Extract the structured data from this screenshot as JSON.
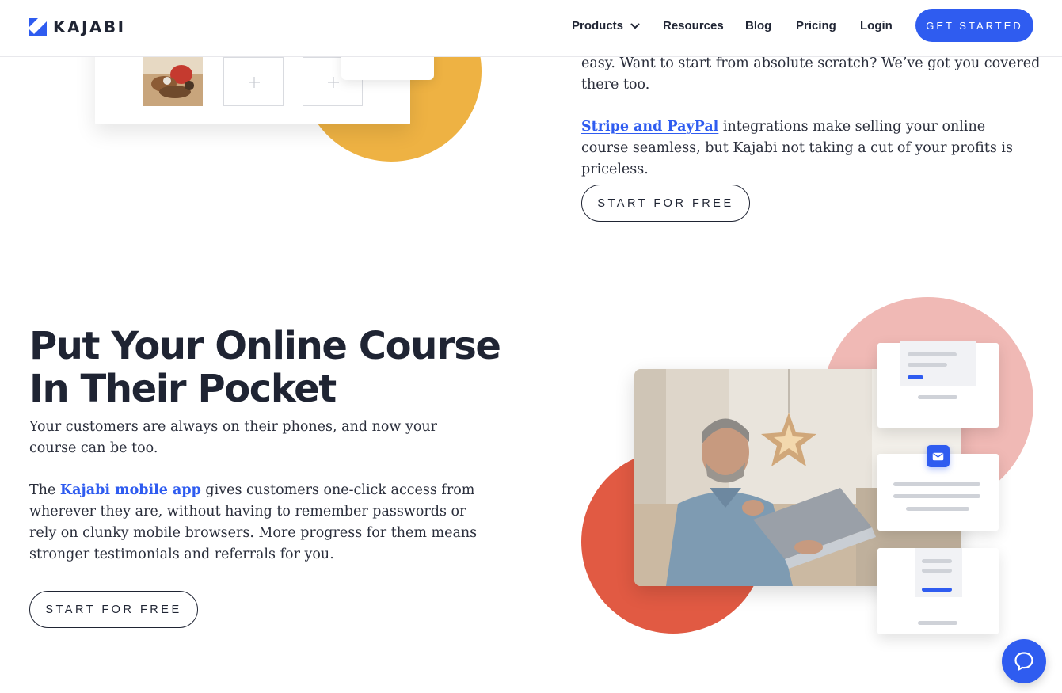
{
  "header": {
    "logo_text": "KAJABI",
    "nav": {
      "products": "Products",
      "resources": "Resources",
      "blog": "Blog",
      "pricing": "Pricing",
      "login": "Login"
    },
    "cta": "GET STARTED"
  },
  "section_top": {
    "paragraph_1": "easy. Want to start from absolute scratch? We’ve got you covered there too.",
    "paragraph_2": {
      "link": "Stripe and PayPal",
      "text": " integrations make selling your online course seamless, but Kajabi not taking a cut of your profits is priceless."
    },
    "button": "START FOR FREE"
  },
  "section_pocket": {
    "headline_line_1": "Put Your Online Course",
    "headline_line_2": "In Their Pocket",
    "paragraph_1": "Your customers are always on their phones, and now your course can be too.",
    "paragraph_2": {
      "prefix": "The ",
      "link": "Kajabi mobile app",
      "text": " gives customers one-click access from wherever they are, without having to remember passwords or rely on clunky mobile browsers. More progress for them means stronger testimonials and referrals for you."
    },
    "button": "START FOR FREE"
  },
  "colors": {
    "brand_blue": "#2f5cf0",
    "yellow": "#eeb243",
    "pink": "#f0b9b5",
    "red": "#e15a43"
  },
  "icons": {
    "logo": "kajabi-logo-mark",
    "products_menu": "chevron-down-icon",
    "add_slot": "plus-icon",
    "mail": "mail-icon",
    "chat": "chat-bubble-icon"
  }
}
